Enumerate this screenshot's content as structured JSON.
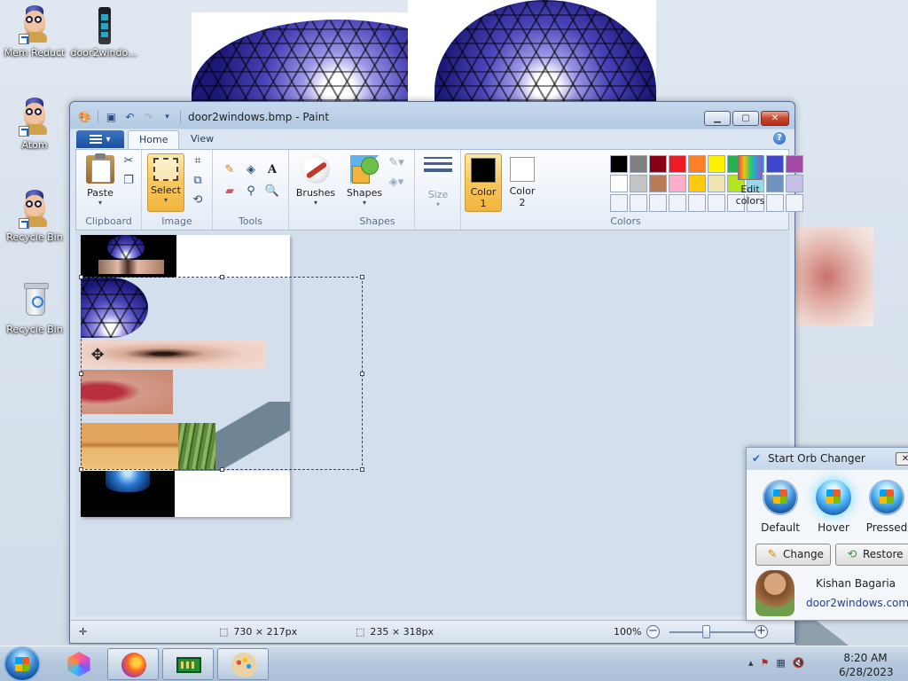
{
  "desktop": {
    "icons": [
      {
        "label": "Mem Reduct",
        "icon": "mem-reduct-icon"
      },
      {
        "label": "door2windo...",
        "icon": "door2windows-icon"
      },
      {
        "label": "Atom",
        "icon": "atom-icon"
      },
      {
        "label": "Recycle Bin",
        "icon": "recycle-bin-shortcut-icon"
      },
      {
        "label": "Recycle Bin",
        "icon": "recycle-bin-icon"
      }
    ]
  },
  "paint": {
    "title": "door2windows.bmp - Paint",
    "tabs": {
      "home": "Home",
      "view": "View"
    },
    "help": "?",
    "ribbon": {
      "clipboard": {
        "label": "Clipboard",
        "paste": "Paste"
      },
      "image": {
        "label": "Image",
        "select": "Select"
      },
      "tools": {
        "label": "Tools"
      },
      "brushes": "Brushes",
      "shapes": {
        "label": "Shapes",
        "button": "Shapes"
      },
      "size": "Size",
      "color1": "Color\n1",
      "color1_l1": "Color",
      "color1_l2": "1",
      "color2_l1": "Color",
      "color2_l2": "2",
      "colors_label": "Colors",
      "edit_colors_l1": "Edit",
      "edit_colors_l2": "colors",
      "primary_color": "#000000",
      "secondary_color": "#ffffff",
      "palette_row1": [
        "#000000",
        "#7f7f7f",
        "#880015",
        "#ed1c24",
        "#ff7f27",
        "#fff200",
        "#22b14c",
        "#00a2e8",
        "#3f48cc",
        "#a349a4"
      ],
      "palette_row2": [
        "#ffffff",
        "#c3c3c3",
        "#b97a57",
        "#ffaec9",
        "#ffc90e",
        "#efe4b0",
        "#b5e61d",
        "#99d9ea",
        "#7092be",
        "#c8bfe7"
      ]
    },
    "status": {
      "selection_size": "730 × 217px",
      "image_size": "235 × 318px",
      "zoom": "100%"
    }
  },
  "orb_changer": {
    "title": "Start Orb Changer",
    "close": "✕",
    "states": [
      "Default",
      "Hover",
      "Pressed"
    ],
    "change": "Change",
    "restore": "Restore",
    "author": "Kishan Bagaria",
    "site": "door2windows.com"
  },
  "taskbar": {
    "time": "8:20 AM",
    "date": "6/28/2023"
  }
}
